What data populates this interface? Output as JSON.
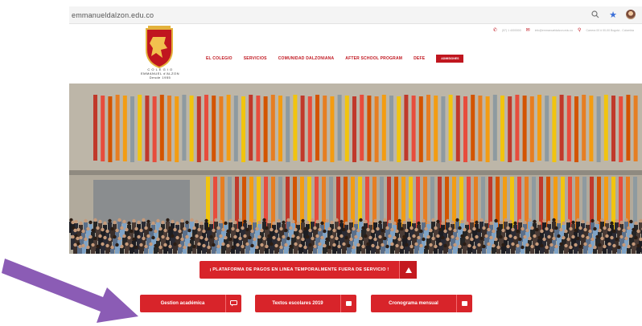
{
  "browser": {
    "url": "emmanueldalzon.edu.co",
    "icons": [
      "zoom-icon",
      "star-icon",
      "profile-avatar"
    ]
  },
  "header": {
    "contacts": [
      {
        "icon": "phone-icon",
        "text": "(57) 1 4000000"
      },
      {
        "icon": "mail-icon",
        "text": "info@emmanueldalzon.edu.co"
      },
      {
        "icon": "location-icon",
        "text": "Carrera 00 # 00-00 Bogotá - Colombia"
      }
    ],
    "logo_lines": [
      "C O L E G I O",
      "EMMANUEL d'ALZON",
      "Desde 1955"
    ],
    "nav": [
      "EL COLEGIO",
      "SERVICIOS",
      "COMUNIDAD DALZONIANA",
      "AFTER SCHOOL PROGRAM",
      "DEFE"
    ],
    "nav_button": "ADMISIONES"
  },
  "alert": {
    "text": "¡ PLATAFORMA DE PAGOS EN LINEA TEMPORALMENTE FUERA DE SERVICIO !"
  },
  "buttons": [
    {
      "label": "Gestion académica",
      "icon": "chat-icon"
    },
    {
      "label": "Textos escolares 2019",
      "icon": "book-icon"
    },
    {
      "label": "Cronograma mensual",
      "icon": "calendar-icon"
    }
  ],
  "colors": {
    "brand_red": "#c0161f",
    "button_red": "#d8242a",
    "annotation_arrow": "#8b5cb5"
  }
}
